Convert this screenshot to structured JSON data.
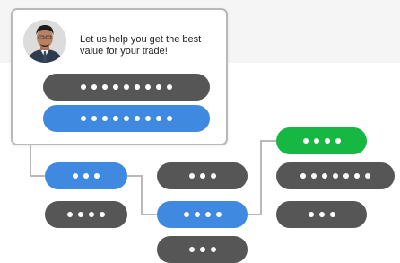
{
  "chat_card": {
    "message": "Let us help you get the best value for your trade!",
    "avatar_icon": "person-avatar"
  },
  "colors": {
    "dark_pill": "#565656",
    "selected_pill": "#3f8ae0",
    "highlight_pill": "#16b743",
    "connector": "#b9b9b9"
  },
  "options": {
    "card_option_1": {
      "dots": 9,
      "state": "default"
    },
    "card_option_2": {
      "dots": 9,
      "state": "selected"
    },
    "step2_option_1": {
      "dots": 3,
      "state": "selected"
    },
    "step2_option_2": {
      "dots": 4,
      "state": "default"
    },
    "step3_option_1": {
      "dots": 3,
      "state": "default"
    },
    "step3_option_2": {
      "dots": 4,
      "state": "selected"
    },
    "step3_option_3": {
      "dots": 3,
      "state": "default"
    },
    "step4_option_1": {
      "dots": 4,
      "state": "highlight"
    },
    "step4_option_2": {
      "dots": 7,
      "state": "default"
    },
    "step4_option_3": {
      "dots": 3,
      "state": "default"
    }
  }
}
